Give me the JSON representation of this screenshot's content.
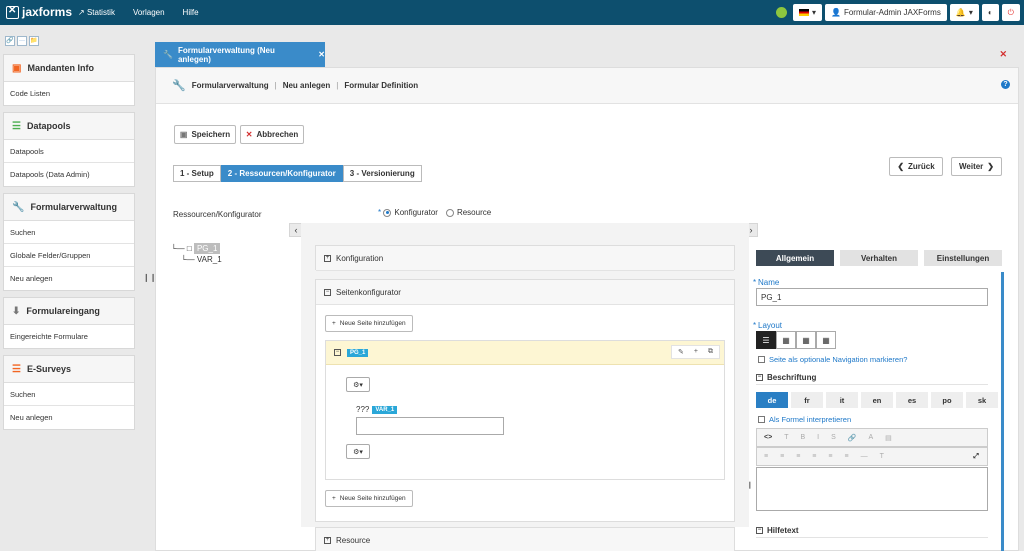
{
  "topbar": {
    "logo": "jaxforms",
    "nav": [
      "Statistik",
      "Vorlagen",
      "Hilfe"
    ],
    "user": "Formular-Admin JAXForms"
  },
  "sidebar": {
    "panels": [
      {
        "title": "Mandanten Info",
        "items": [
          "Code Listen"
        ]
      },
      {
        "title": "Datapools",
        "items": [
          "Datapools",
          "Datapools (Data Admin)"
        ]
      },
      {
        "title": "Formularverwaltung",
        "items": [
          "Suchen",
          "Globale Felder/Gruppen",
          "Neu anlegen"
        ]
      },
      {
        "title": "Formulareingang",
        "items": [
          "Eingereichte Formulare"
        ]
      },
      {
        "title": "E-Surveys",
        "items": [
          "Suchen",
          "Neu anlegen"
        ]
      }
    ]
  },
  "main": {
    "tab_label": "Formularverwaltung (Neu anlegen)",
    "breadcrumb": [
      "Formularverwaltung",
      "Neu anlegen",
      "Formular Definition"
    ],
    "save_label": "Speichern",
    "cancel_label": "Abbrechen",
    "steps": [
      "1 - Setup",
      "2 - Ressourcen/Konfigurator",
      "3 - Versionierung"
    ],
    "back_label": "Zurück",
    "next_label": "Weiter",
    "ress_label": "Ressourcen/Konfigurator",
    "radio_options": [
      "Konfigurator",
      "Resource"
    ],
    "tree": {
      "root": "PG_1",
      "child": "VAR_1"
    }
  },
  "middle": {
    "section_konfiguration": "Konfiguration",
    "section_seiten": "Seitenkonfigurator",
    "section_resource": "Resource",
    "add_page_label": "Neue Seite hinzufügen",
    "page_badge": "PG_1",
    "var_prefix": "???",
    "var_badge": "VAR_1"
  },
  "right": {
    "tabs": [
      "Allgemein",
      "Verhalten",
      "Einstellungen"
    ],
    "name_label": "Name",
    "name_value": "PG_1",
    "layout_label": "Layout",
    "nav_checkbox": "Seite als optionale Navigation markieren?",
    "beschriftung": "Beschriftung",
    "languages": [
      "de",
      "fr",
      "it",
      "en",
      "es",
      "po",
      "sk"
    ],
    "formula_checkbox": "Als Formel interpretieren",
    "hilfetext": "Hilfetext"
  }
}
